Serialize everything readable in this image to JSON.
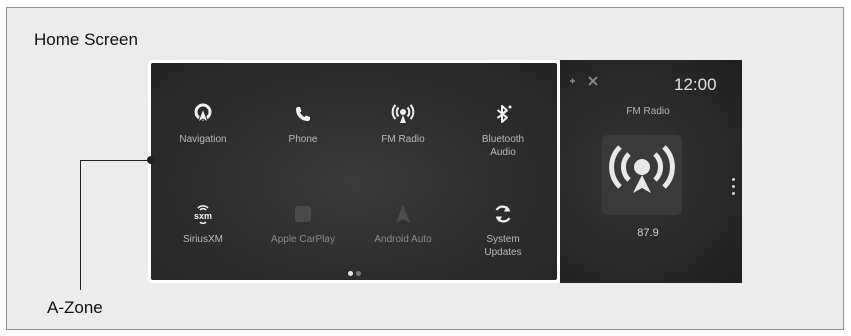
{
  "frame": {
    "title": "Home Screen",
    "callout_label": "A-Zone"
  },
  "azone": {
    "apps": [
      {
        "label": "Navigation",
        "icon": "navigation-icon"
      },
      {
        "label": "Phone",
        "icon": "phone-icon"
      },
      {
        "label": "FM Radio",
        "icon": "fm-radio-icon"
      },
      {
        "label": "Bluetooth\nAudio",
        "icon": "bluetooth-icon"
      },
      {
        "label": "SiriusXM",
        "icon": "siriusxm-icon"
      },
      {
        "label": "Apple CarPlay",
        "icon": "apple-carplay-icon"
      },
      {
        "label": "Android Auto",
        "icon": "android-auto-icon"
      },
      {
        "label": "System\nUpdates",
        "icon": "system-updates-icon"
      }
    ],
    "page_indicator": {
      "current": 1,
      "total": 2
    }
  },
  "right_panel": {
    "clock": "12:00",
    "source_title": "FM Radio",
    "frequency": "87.9"
  },
  "colors": {
    "screen_bg": "#2c2c2c",
    "label_text": "#b9b9b9",
    "frame_bg": "#ececec"
  }
}
